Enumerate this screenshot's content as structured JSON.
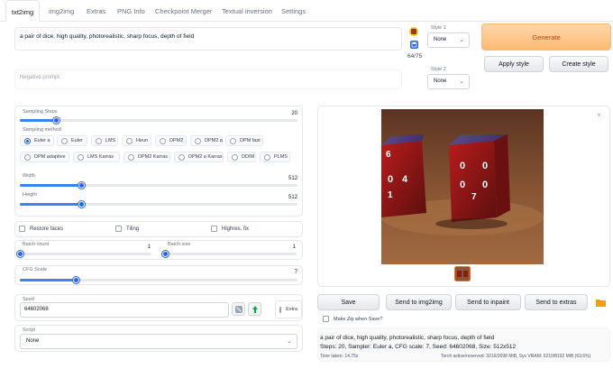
{
  "tabs": [
    "txt2img",
    "img2img",
    "Extras",
    "PNG Info",
    "Checkpoint Merger",
    "Textual inversion",
    "Settings"
  ],
  "prompt": {
    "text": "a pair of dice, high quality, photorealistic, sharp focus, depth of field",
    "token_count": "64/75"
  },
  "negative_prompt": {
    "placeholder": "Negative prompt"
  },
  "style1": {
    "label": "Style 1",
    "value": "None"
  },
  "style2": {
    "label": "Style 2",
    "value": "None"
  },
  "buttons": {
    "generate": "Generate",
    "apply_style": "Apply style",
    "create_style": "Create style"
  },
  "sampling_steps": {
    "label": "Sampling Steps",
    "value": "20",
    "fraction": 0.13
  },
  "sampling_method": {
    "label": "Sampling method",
    "selected": "Euler a",
    "options": [
      "Euler a",
      "Euler",
      "LMS",
      "Heun",
      "DPM2",
      "DPM2 a",
      "DPM fast",
      "DPM adaptive",
      "LMS Karras",
      "DPM2 Karras",
      "DPM2 a Karras",
      "DDIM",
      "PLMS"
    ]
  },
  "width": {
    "label": "Width",
    "value": "512",
    "fraction": 0.22
  },
  "height": {
    "label": "Height",
    "value": "512",
    "fraction": 0.22
  },
  "checkboxes": {
    "restore_faces": "Restore faces",
    "tiling": "Tiling",
    "highres_fix": "Highres. fix"
  },
  "batch_count": {
    "label": "Batch count",
    "value": "1",
    "fraction": 0.0
  },
  "batch_size": {
    "label": "Batch size",
    "value": "1",
    "fraction": 0.0
  },
  "cfg_scale": {
    "label": "CFG Scale",
    "value": "7",
    "fraction": 0.2
  },
  "seed": {
    "label": "Seed",
    "value": "64602068",
    "extra_label": "Extra"
  },
  "script": {
    "label": "Script",
    "value": "None"
  },
  "output_buttons": {
    "save": "Save",
    "send_img2img": "Send to img2img",
    "send_inpaint": "Send to inpaint",
    "send_extras": "Send to extras"
  },
  "make_zip_label": "Make Zip when Save?",
  "output_info": {
    "prompt": "a pair of dice, high quality, photorealistic, sharp focus, depth of field",
    "params": "Steps: 20, Sampler: Euler a, CFG scale: 7, Seed: 64602068, Size: 512x512",
    "time_taken": "Time taken: 14.75s",
    "vram": "Torch active/reserved: 3216/3698 MiB, Sys VRAM: 5210/8192 MiB (63.6%)"
  },
  "dice_faces": {
    "left": [
      "6",
      "4",
      "1",
      "0"
    ],
    "right": [
      "0",
      "0",
      "0",
      "0",
      "7"
    ]
  },
  "colors": {
    "accent": "#3b82f6",
    "generate_bg": "#fdba74",
    "generate_text": "#c2410c",
    "dice": "#8b1a1a"
  },
  "icons": {
    "paste": "notebook-icon",
    "save_style": "floppy-icon",
    "random_seed": "dice-icon",
    "reuse_seed": "recycle-icon",
    "open_folder": "folder-icon",
    "close": "close-icon"
  }
}
